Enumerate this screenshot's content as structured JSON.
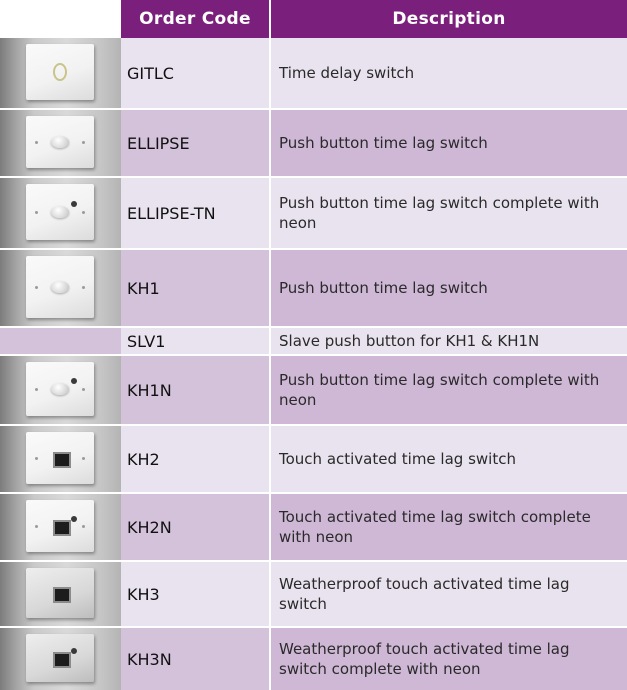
{
  "headers": {
    "order_code": "Order Code",
    "description": "Description"
  },
  "rows": [
    {
      "code": "GITLC",
      "description": "Time delay switch",
      "image": "round-dial-switch"
    },
    {
      "code": "ELLIPSE",
      "description": "Push button time lag switch",
      "image": "push-button-switch"
    },
    {
      "code": "ELLIPSE-TN",
      "description": "Push button time lag switch complete with neon",
      "image": "push-button-neon-switch"
    },
    {
      "code": "KH1",
      "description": "Push button time lag switch",
      "image": "push-button-switch"
    },
    {
      "code": "SLV1",
      "description": "Slave push button for KH1 & KH1N",
      "image": ""
    },
    {
      "code": "KH1N",
      "description": "Push button time lag switch complete with neon",
      "image": "push-button-neon-switch"
    },
    {
      "code": "KH2",
      "description": "Touch activated time lag switch",
      "image": "touch-switch"
    },
    {
      "code": "KH2N",
      "description": "Touch activated time lag switch complete with neon",
      "image": "touch-neon-switch"
    },
    {
      "code": "KH3",
      "description": "Weatherproof touch activated time lag switch",
      "image": "weatherproof-touch-switch"
    },
    {
      "code": "KH3N",
      "description": "Weatherproof touch activated time lag switch complete with neon",
      "image": "weatherproof-touch-neon-switch"
    }
  ],
  "colors": {
    "header": "#7b1f7d",
    "row_light": "#e9e3ef",
    "row_dark": "#d3c2da"
  }
}
